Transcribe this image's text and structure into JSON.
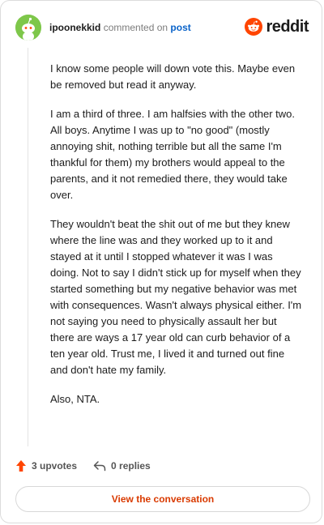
{
  "comment": {
    "author": "ipoonekkid",
    "action_text": "commented on",
    "post_link": "post",
    "paragraphs": [
      "I know some people will down vote this. Maybe even be removed but read it anyway.",
      "I am a third of three. I am halfsies with the other two. All boys. Anytime I was up to \"no good\" (mostly annoying shit, nothing terrible but all the same I'm thankful for them) my brothers would appeal to the parents, and it not remedied there, they would take over.",
      "They wouldn't beat the shit out of me but they knew where the line was and they worked up to it and stayed at it until I stopped whatever it was I was doing. Not to say I didn't stick up for myself when they started something but my negative behavior was met with consequences. Wasn't always physical either. I'm not saying you need to physically assault her but there are ways a 17 year old can curb behavior of a ten year old. Trust me, I lived it and turned out fine and don't hate my family.",
      "Also, NTA."
    ]
  },
  "brand": {
    "wordmark": "reddit",
    "icon": "reddit-snoo-icon",
    "color": "#ff4500"
  },
  "avatar": {
    "icon": "snoo-avatar-icon",
    "color": "#7ec74a"
  },
  "footer": {
    "upvotes_label": "3 upvotes",
    "upvote_icon": "upvote-arrow-icon",
    "replies_label": "0 replies",
    "reply_icon": "reply-arrow-icon"
  },
  "cta": {
    "label": "View the conversation",
    "color": "#d93a00"
  }
}
